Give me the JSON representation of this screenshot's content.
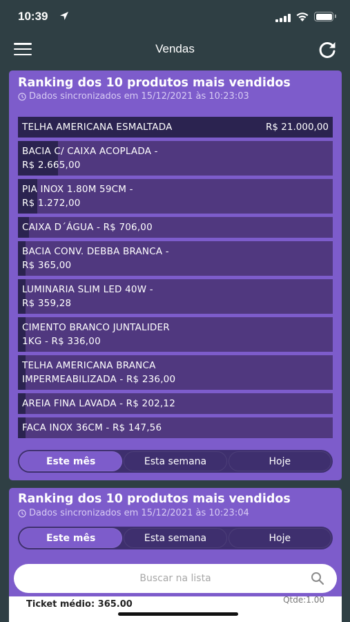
{
  "status": {
    "time": "10:39"
  },
  "nav": {
    "title": "Vendas",
    "menu_icon": "hamburger-menu-icon",
    "refresh_icon": "refresh-icon"
  },
  "colors": {
    "background": "#2f3f44",
    "card": "#7d5ccb",
    "row": "#50387f",
    "row_bar": "#2b2350",
    "segment_bg": "#3e2f6e"
  },
  "card1": {
    "title": "Ranking dos 10 produtos mais vendidos",
    "subtitle": "Dados sincronizados em 15/12/2021 às 10:23:03",
    "items": [
      {
        "line1": "TELHA AMERICANA ESMALTADA",
        "line2": "",
        "price_right": "R$ 21.000,00",
        "share": 1.0
      },
      {
        "line1": "BACIA C/ CAIXA ACOPLADA -",
        "line2": "R$ 2.665,00",
        "price_right": "",
        "share": 0.127
      },
      {
        "line1": "PIA INOX 1.80M 59CM -",
        "line2": "R$ 1.272,00",
        "price_right": "",
        "share": 0.061
      },
      {
        "line1": "CAIXA D´ÁGUA - R$ 706,00",
        "line2": "",
        "price_right": "",
        "share": 0.034
      },
      {
        "line1": "BACIA CONV. DEBBA BRANCA -",
        "line2": "R$ 365,00",
        "price_right": "",
        "share": 0.017
      },
      {
        "line1": "LUMINARIA SLIM LED 40W -",
        "line2": "R$ 359,28",
        "price_right": "",
        "share": 0.017
      },
      {
        "line1": "CIMENTO BRANCO JUNTALIDER",
        "line2": "1KG - R$ 336,00",
        "price_right": "",
        "share": 0.016
      },
      {
        "line1": "TELHA AMERICANA BRANCA",
        "line2": "IMPERMEABILIZADA - R$ 236,00",
        "price_right": "",
        "share": 0.011
      },
      {
        "line1": "AREIA FINA LAVADA - R$ 202,12",
        "line2": "",
        "price_right": "",
        "share": 0.01
      },
      {
        "line1": "FACA INOX 36CM - R$ 147,56",
        "line2": "",
        "price_right": "",
        "share": 0.007
      }
    ],
    "tabs": [
      "Este mês",
      "Esta semana",
      "Hoje"
    ],
    "active_tab": 0
  },
  "card2": {
    "title": "Ranking dos 10 produtos mais vendidos",
    "subtitle": "Dados sincronizados em 15/12/2021 às 10:23:04",
    "tabs": [
      "Este mês",
      "Esta semana",
      "Hoje"
    ],
    "active_tab": 0,
    "search": {
      "placeholder": "Buscar na lista",
      "value": ""
    },
    "ticket": "Ticket médio: 365.00",
    "qtde": "Qtde:1.00"
  }
}
